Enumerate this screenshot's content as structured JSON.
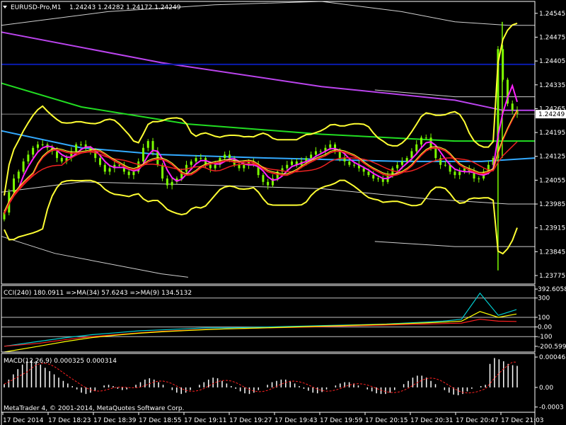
{
  "header": {
    "symbol": "EURUSD-Pro,M1",
    "ohlc": "1.24243 1.24282 1.24172 1.24249"
  },
  "footer": {
    "copyright": "MetaTrader 4, © 2001-2014, MetaQuotes Software Corp."
  },
  "colors": {
    "background": "#000000",
    "candles": "#7CFC00",
    "bollinger": "#FFFF33",
    "envelope": "#D0D0D0",
    "ma_green": "#22DD22",
    "ma_violet": "#BB44EE",
    "ma_blue_dark": "#0A1AAA",
    "ma_sky": "#33AAFF",
    "ma_red": "#EE2222",
    "ma_magenta": "#FF22FF",
    "cci_cyan": "#00CED1",
    "cci_red": "#FF2020",
    "cci_yellow": "#FFFF00",
    "macd_hist": "#FFFFFF",
    "macd_signal": "#FF2020"
  },
  "chart_data": [
    {
      "type": "line",
      "name": "main",
      "title": "EURUSD-Pro,M1",
      "ylim": [
        1.2375,
        1.2458
      ],
      "y_ticks": [
        "1.24545",
        "1.24475",
        "1.24405",
        "1.24335",
        "1.24265",
        "1.24195",
        "1.24125",
        "1.24055",
        "1.23985",
        "1.23915",
        "1.23845",
        "1.23775"
      ],
      "y_tick_values": [
        1.24545,
        1.24475,
        1.24405,
        1.24335,
        1.24265,
        1.24195,
        1.24125,
        1.24055,
        1.23985,
        1.23915,
        1.23845,
        1.23775
      ],
      "x_ticks": [
        "17 Dec 2014",
        "17 Dec 18:23",
        "17 Dec 18:39",
        "17 Dec 18:55",
        "17 Dec 19:11",
        "17 Dec 19:27",
        "17 Dec 19:43",
        "17 Dec 19:59",
        "17 Dec 20:15",
        "17 Dec 20:31",
        "17 Dec 20:47",
        "17 Dec 21:03"
      ],
      "current_price": "1.24249",
      "current_value": 1.24249,
      "horizontal_level": 1.24395,
      "close": [
        1.2396,
        1.2402,
        1.2406,
        1.2408,
        1.2411,
        1.2413,
        1.2415,
        1.2416,
        1.2416,
        1.2415,
        1.2414,
        1.2412,
        1.2411,
        1.2412,
        1.2414,
        1.2416,
        1.2416,
        1.2415,
        1.2414,
        1.2412,
        1.241,
        1.2408,
        1.2409,
        1.241,
        1.241,
        1.2408,
        1.2407,
        1.2408,
        1.2411,
        1.2415,
        1.2417,
        1.2414,
        1.241,
        1.2406,
        1.2404,
        1.2405,
        1.2406,
        1.2408,
        1.241,
        1.2411,
        1.2412,
        1.2412,
        1.241,
        1.2409,
        1.241,
        1.2412,
        1.2413,
        1.2412,
        1.241,
        1.2409,
        1.241,
        1.2411,
        1.241,
        1.2407,
        1.2405,
        1.2404,
        1.2406,
        1.2408,
        1.2409,
        1.241,
        1.2411,
        1.241,
        1.2411,
        1.2412,
        1.2413,
        1.2414,
        1.2414,
        1.2415,
        1.2416,
        1.2414,
        1.2412,
        1.2411,
        1.241,
        1.241,
        1.2409,
        1.2408,
        1.2407,
        1.2406,
        1.2406,
        1.2405,
        1.2407,
        1.2409,
        1.241,
        1.2411,
        1.2412,
        1.2414,
        1.2416,
        1.2418,
        1.2418,
        1.2415,
        1.2412,
        1.241,
        1.241,
        1.2408,
        1.2407,
        1.2408,
        1.2409,
        1.2408,
        1.2406,
        1.2406,
        1.2408,
        1.241,
        1.2412,
        1.2444,
        1.2435,
        1.2428,
        1.2426,
        1.2425
      ],
      "series": [
        {
          "role": "ma_violet",
          "color": "#BB44EE",
          "values": [
            [
              0,
              1.2449
            ],
            [
              0.3,
              1.244
            ],
            [
              0.6,
              1.2433
            ],
            [
              0.85,
              1.2429
            ],
            [
              0.94,
              1.2426
            ],
            [
              1,
              1.2426
            ]
          ]
        },
        {
          "role": "ma_blue_dark",
          "color": "#0A1AAA",
          "values": [
            [
              0,
              1.24395
            ],
            [
              1,
              1.24395
            ]
          ]
        },
        {
          "role": "ma_green",
          "color": "#22DD22",
          "values": [
            [
              0,
              1.2434
            ],
            [
              0.15,
              1.2427
            ],
            [
              0.35,
              1.2422
            ],
            [
              0.6,
              1.2419
            ],
            [
              0.85,
              1.2417
            ],
            [
              1,
              1.2417
            ]
          ]
        },
        {
          "role": "ma_sky",
          "color": "#33AAFF",
          "values": [
            [
              0,
              1.242
            ],
            [
              0.15,
              1.2415
            ],
            [
              0.3,
              1.2413
            ],
            [
              0.5,
              1.2412
            ],
            [
              0.75,
              1.2411
            ],
            [
              0.9,
              1.2411
            ],
            [
              1,
              1.2412
            ]
          ]
        },
        {
          "role": "env_upper",
          "color": "#D0D0D0",
          "values": [
            [
              0,
              1.2451
            ],
            [
              0.2,
              1.2455
            ],
            [
              0.4,
              1.2457
            ],
            [
              0.6,
              1.2458
            ],
            [
              0.75,
              1.2455
            ],
            [
              0.85,
              1.2452
            ],
            [
              0.95,
              1.2451
            ],
            [
              1,
              1.2451
            ]
          ]
        },
        {
          "role": "env_mid_upper",
          "color": "#D0D0D0",
          "values": [
            [
              0.7,
              1.2432
            ],
            [
              0.85,
              1.243
            ],
            [
              1,
              1.243
            ]
          ]
        },
        {
          "role": "env_lower",
          "color": "#D0D0D0",
          "values": [
            [
              0,
              1.2402
            ],
            [
              0.15,
              1.2405
            ],
            [
              0.4,
              1.2404
            ],
            [
              0.6,
              1.2403
            ],
            [
              0.8,
              1.24
            ],
            [
              0.95,
              1.23985
            ],
            [
              1,
              1.23985
            ]
          ]
        },
        {
          "role": "env_lower2",
          "color": "#D0D0D0",
          "values": [
            [
              0,
              1.2389
            ],
            [
              0.1,
              1.2384
            ],
            [
              0.3,
              1.2378
            ],
            [
              0.35,
              1.2377
            ]
          ]
        },
        {
          "role": "env_lower3",
          "color": "#D0D0D0",
          "values": [
            [
              0.7,
              1.23875
            ],
            [
              0.85,
              1.2386
            ],
            [
              1,
              1.2386
            ]
          ]
        }
      ]
    },
    {
      "type": "line",
      "name": "cci",
      "title": "CCI(240) 180.0911  =>MA(34) 57.6243  =>MA(9) 134.5132",
      "ylim": [
        -260,
        430
      ],
      "y_ticks": [
        "392.6058",
        "300",
        "100",
        "0.00",
        "-100",
        "-200.5992"
      ],
      "y_tick_values": [
        392.6058,
        300,
        100,
        0,
        -100,
        -200.5992
      ],
      "levels": [
        300,
        100,
        0,
        -100
      ],
      "series": [
        {
          "name": "CCI(240)",
          "color": "#00CED1",
          "values": [
            -200,
            -150,
            -110,
            -80,
            -60,
            -40,
            -30,
            -20,
            -10,
            -10,
            -5,
            0,
            5,
            10,
            15,
            20,
            25,
            30,
            40,
            50,
            60,
            80,
            350,
            120,
            180
          ]
        },
        {
          "name": "MA(34)",
          "color": "#FF2020",
          "values": [
            -200,
            -170,
            -130,
            -100,
            -80,
            -60,
            -45,
            -35,
            -25,
            -20,
            -15,
            -10,
            -5,
            0,
            5,
            10,
            15,
            20,
            25,
            30,
            35,
            40,
            80,
            60,
            57
          ]
        },
        {
          "name": "MA(9)",
          "color": "#FFFF00",
          "values": [
            -260,
            -200,
            -150,
            -110,
            -85,
            -65,
            -50,
            -38,
            -28,
            -20,
            -14,
            -8,
            -2,
            4,
            10,
            16,
            22,
            28,
            35,
            42,
            50,
            60,
            160,
            100,
            134
          ]
        }
      ]
    },
    {
      "type": "bar",
      "name": "macd",
      "title": "MACD(12,26,9) 0.000325 0.000314",
      "ylim": [
        -0.00038,
        0.00052
      ],
      "y_ticks": [
        "0.000465",
        "0.00",
        "-0.0003"
      ],
      "y_tick_values": [
        0.000465,
        0,
        -0.0003
      ],
      "histogram": [
        5e-05,
        0.00012,
        0.0002,
        0.00028,
        0.00035,
        0.0004,
        0.00042,
        0.0004,
        0.00035,
        0.0003,
        0.00025,
        0.0002,
        0.00015,
        0.0001,
        6e-05,
        2e-05,
        -3e-05,
        -8e-05,
        -0.0001,
        -8e-05,
        -5e-05,
        0.0,
        3e-05,
        4e-05,
        2e-05,
        -2e-05,
        -4e-05,
        -3e-05,
        0.0,
        4e-05,
        8e-05,
        0.00012,
        0.00014,
        0.00012,
        8e-05,
        4e-05,
        0.0,
        -4e-05,
        -8e-05,
        -0.0001,
        -8e-05,
        -4e-05,
        0.0,
        4e-05,
        8e-05,
        0.00012,
        0.00015,
        0.00014,
        0.0001,
        6e-05,
        2e-05,
        -2e-05,
        -6e-05,
        -9e-05,
        -0.0001,
        -8e-05,
        -4e-05,
        0.0,
        4e-05,
        8e-05,
        0.0001,
        0.00012,
        0.00012,
        0.0001,
        6e-05,
        2e-05,
        -2e-05,
        -5e-05,
        -8e-05,
        -9e-05,
        -7e-05,
        -3e-05,
        0.0,
        3e-05,
        6e-05,
        8e-05,
        8e-05,
        6e-05,
        3e-05,
        0.0,
        -3e-05,
        -6e-05,
        -9e-05,
        -0.0001,
        -0.0001,
        -8e-05,
        -4e-05,
        0.0,
        5e-05,
        0.0001,
        0.00015,
        0.00018,
        0.00018,
        0.00015,
        0.0001,
        5e-05,
        0.0,
        -4e-05,
        -8e-05,
        -0.00011,
        -0.00012,
        -0.0001,
        -6e-05,
        -2e-05,
        0.0,
        2e-05,
        4e-05,
        0.00036,
        0.00045,
        0.00043,
        0.0004,
        0.00036,
        0.00034,
        0.00033
      ]
    }
  ]
}
